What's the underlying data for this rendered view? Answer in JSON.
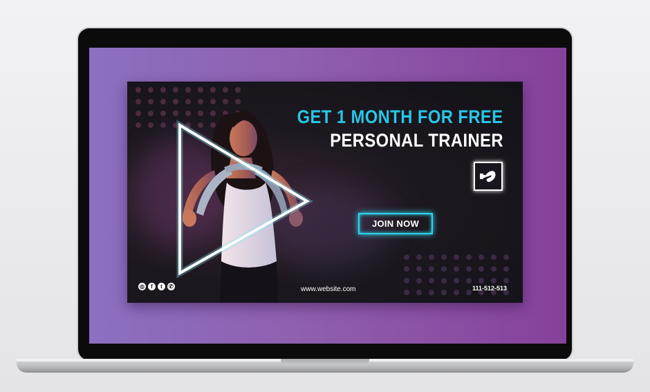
{
  "banner": {
    "headline_line1": "GET 1 MONTH FOR FREE",
    "headline_line2": "PERSONAL TRAINER",
    "cta_label": "JOIN NOW",
    "website": "www.website.com",
    "phone": "111-512-513",
    "social_icons": [
      "instagram-icon",
      "facebook-icon",
      "twitter-icon",
      "whatsapp-icon"
    ],
    "logo_icon": "muscle-arm-icon",
    "colors": {
      "accent_cyan": "#27c7e6",
      "banner_bg": "#16161b",
      "screen_gradient_left": "#8c70c2",
      "screen_gradient_right": "#86419a"
    }
  }
}
